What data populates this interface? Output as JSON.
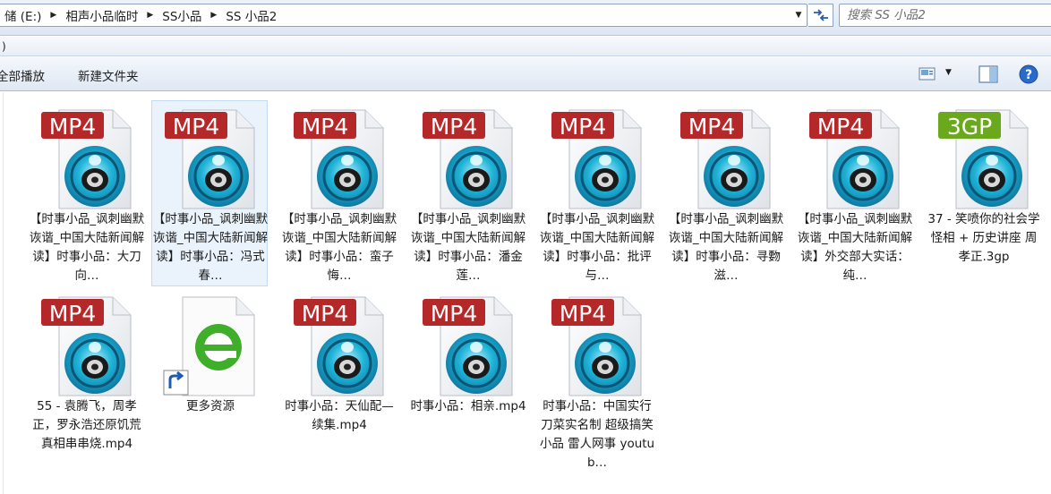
{
  "address": {
    "breadcrumbs": [
      "储 (E:)",
      "相声小品临时",
      "SS小品",
      "SS 小品2"
    ]
  },
  "search": {
    "placeholder": "搜索 SS 小品2"
  },
  "menu": {
    "items": [
      ")"
    ]
  },
  "toolbar": {
    "play_all_label": "全部播放",
    "new_folder_label": "新建文件夹"
  },
  "colors": {
    "mp4_badge": "#b5282a",
    "gp3_badge": "#6aa81e",
    "disc_cyan": "#1fb4d8",
    "selection": "#eaf3fc"
  },
  "files": [
    {
      "name": "【时事小品_讽刺幽默诙谐_中国大陆新闻解读】时事小品：大刀向…",
      "type": "MP4",
      "icon": "video-mp4-icon"
    },
    {
      "name": "【时事小品_讽刺幽默诙谐_中国大陆新闻解读】时事小品：冯式春…",
      "type": "MP4",
      "icon": "video-mp4-icon",
      "selected": true
    },
    {
      "name": "【时事小品_讽刺幽默诙谐_中国大陆新闻解读】时事小品：蛮子悔…",
      "type": "MP4",
      "icon": "video-mp4-icon"
    },
    {
      "name": "【时事小品_讽刺幽默诙谐_中国大陆新闻解读】时事小品：潘金莲…",
      "type": "MP4",
      "icon": "video-mp4-icon"
    },
    {
      "name": "【时事小品_讽刺幽默诙谐_中国大陆新闻解读】时事小品：批评与…",
      "type": "MP4",
      "icon": "video-mp4-icon"
    },
    {
      "name": "【时事小品_讽刺幽默诙谐_中国大陆新闻解读】时事小品：寻覅滋…",
      "type": "MP4",
      "icon": "video-mp4-icon"
    },
    {
      "name": "【时事小品_讽刺幽默诙谐_中国大陆新闻解读】外交部大实话：纯…",
      "type": "MP4",
      "icon": "video-mp4-icon"
    },
    {
      "name": "37 - 笑喷你的社会学怪相 + 历史讲座 周孝正.3gp",
      "type": "3GP",
      "icon": "video-3gp-icon"
    },
    {
      "name": "55 - 袁腾飞，周孝正，罗永浩还原饥荒真相串串烧.mp4",
      "type": "MP4",
      "icon": "video-mp4-icon"
    },
    {
      "name": "更多资源",
      "type": "shortcut",
      "icon": "browser-shortcut-icon"
    },
    {
      "name": "时事小品：天仙配—续集.mp4",
      "type": "MP4",
      "icon": "video-mp4-icon"
    },
    {
      "name": "时事小品：相亲.mp4",
      "type": "MP4",
      "icon": "video-mp4-icon"
    },
    {
      "name": "时事小品：中国实行刀菜实名制 超级搞笑小品 雷人网事 youtub…",
      "type": "MP4",
      "icon": "video-mp4-icon"
    }
  ]
}
